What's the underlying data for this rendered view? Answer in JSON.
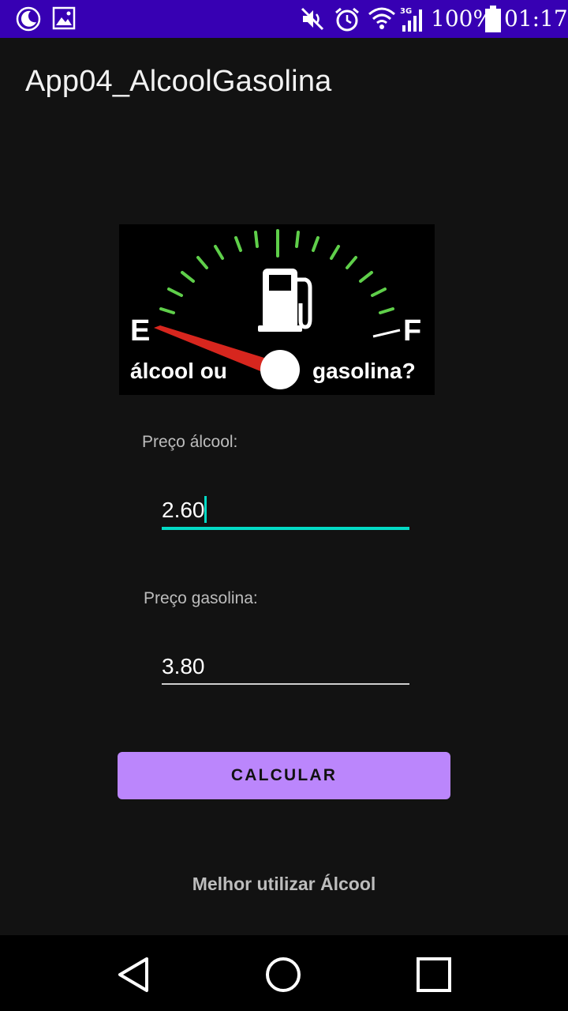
{
  "status_bar": {
    "battery_percent": "100%",
    "time": "01:17",
    "network": "3G",
    "icons": [
      "moon-icon",
      "image-icon",
      "mute-icon",
      "alarm-icon",
      "wifi-icon",
      "signal-icon",
      "battery-icon"
    ]
  },
  "app": {
    "title": "App04_AlcoolGasolina"
  },
  "gauge": {
    "empty_letter": "E",
    "full_letter": "F",
    "left_text": "álcool ou",
    "right_text": "gasolina?"
  },
  "form": {
    "alcool_label": "Preço álcool:",
    "alcool_value": "2.60",
    "gasolina_label": "Preço gasolina:",
    "gasolina_value": "3.80",
    "calc_button": "CALCULAR"
  },
  "result": {
    "text": "Melhor utilizar Álcool"
  },
  "colors": {
    "status_bar": "#3700b3",
    "background": "#121212",
    "accent": "#03dac5",
    "button": "#bb86fc"
  }
}
